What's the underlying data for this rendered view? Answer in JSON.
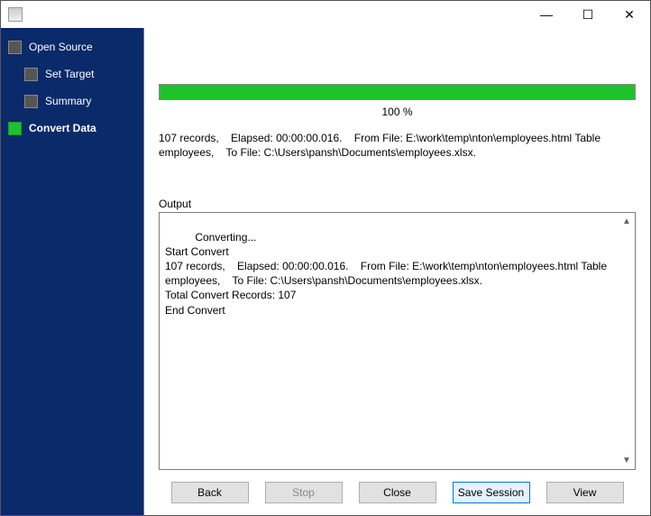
{
  "titlebar": {
    "minimize": "—",
    "maximize": "☐",
    "close": "✕"
  },
  "sidebar": {
    "items": [
      {
        "label": "Open Source"
      },
      {
        "label": "Set Target"
      },
      {
        "label": "Summary"
      },
      {
        "label": "Convert Data"
      }
    ]
  },
  "progress": {
    "percent_label": "100 %"
  },
  "summary_line": "107 records,    Elapsed: 00:00:00.016.    From File: E:\\work\\temp\\nton\\employees.html Table employees,    To File: C:\\Users\\pansh\\Documents\\employees.xlsx.",
  "output": {
    "label": "Output",
    "text": "Converting...\nStart Convert\n107 records,    Elapsed: 00:00:00.016.    From File: E:\\work\\temp\\nton\\employees.html Table employees,    To File: C:\\Users\\pansh\\Documents\\employees.xlsx.\nTotal Convert Records: 107\nEnd Convert"
  },
  "buttons": {
    "back": "Back",
    "stop": "Stop",
    "close": "Close",
    "save_session": "Save Session",
    "view": "View"
  }
}
